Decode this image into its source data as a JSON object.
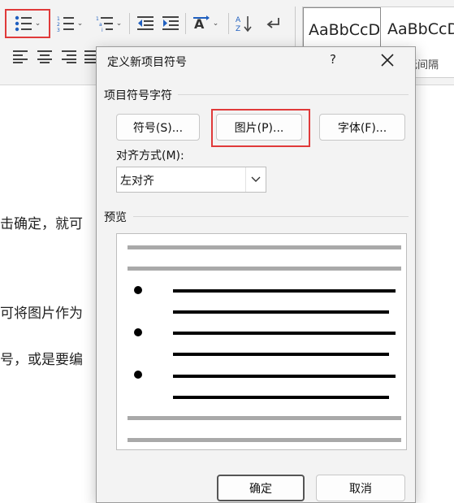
{
  "ribbon": {
    "style_gallery": [
      {
        "sample": "AaBbCcD",
        "selected": true
      },
      {
        "sample": "AaBbCcD",
        "selected": false
      }
    ],
    "style_partial_label": "无间隔",
    "icons": [
      "bullet-list-icon",
      "numbered-list-icon",
      "multilevel-list-icon",
      "decrease-indent-icon",
      "increase-indent-icon",
      "text-direction-icon",
      "sort-icon",
      "show-marks-icon",
      "align-left-icon",
      "align-center-icon",
      "align-right-icon",
      "justify-icon"
    ]
  },
  "document": {
    "lines": [
      "击确定，就可",
      "可将图片作为",
      "号，或是要编"
    ]
  },
  "dialog": {
    "title": "定义新项目符号",
    "help": "?",
    "section_bullet_char": "项目符号字符",
    "buttons": {
      "symbol": "符号(S)...",
      "picture": "图片(P)...",
      "font": "字体(F)..."
    },
    "alignment_label": "对齐方式(M):",
    "alignment_value": "左对齐",
    "preview_label": "预览",
    "ok": "确定",
    "cancel": "取消"
  }
}
